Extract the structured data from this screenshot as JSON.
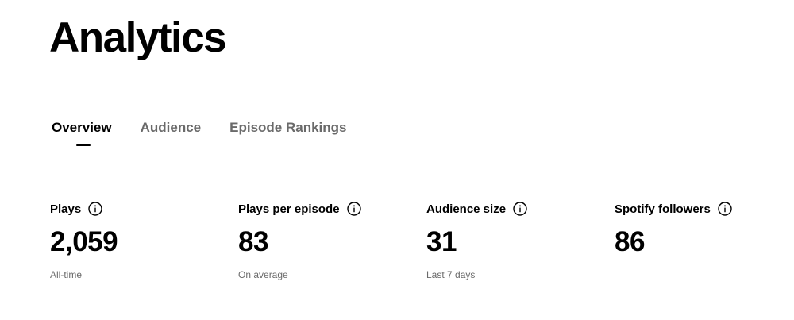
{
  "header": {
    "title": "Analytics"
  },
  "tabs": [
    {
      "label": "Overview",
      "active": true
    },
    {
      "label": "Audience",
      "active": false
    },
    {
      "label": "Episode Rankings",
      "active": false
    }
  ],
  "metrics": [
    {
      "label": "Plays",
      "value": "2,059",
      "caption": "All-time",
      "icon": "info-icon"
    },
    {
      "label": "Plays per episode",
      "value": "83",
      "caption": "On average",
      "icon": "info-icon"
    },
    {
      "label": "Audience size",
      "value": "31",
      "caption": "Last 7 days",
      "icon": "info-icon"
    },
    {
      "label": "Spotify followers",
      "value": "86",
      "caption": "",
      "icon": "info-icon"
    }
  ],
  "colors": {
    "text_primary": "#000000",
    "text_secondary": "#6a6a6a",
    "background": "#ffffff"
  }
}
